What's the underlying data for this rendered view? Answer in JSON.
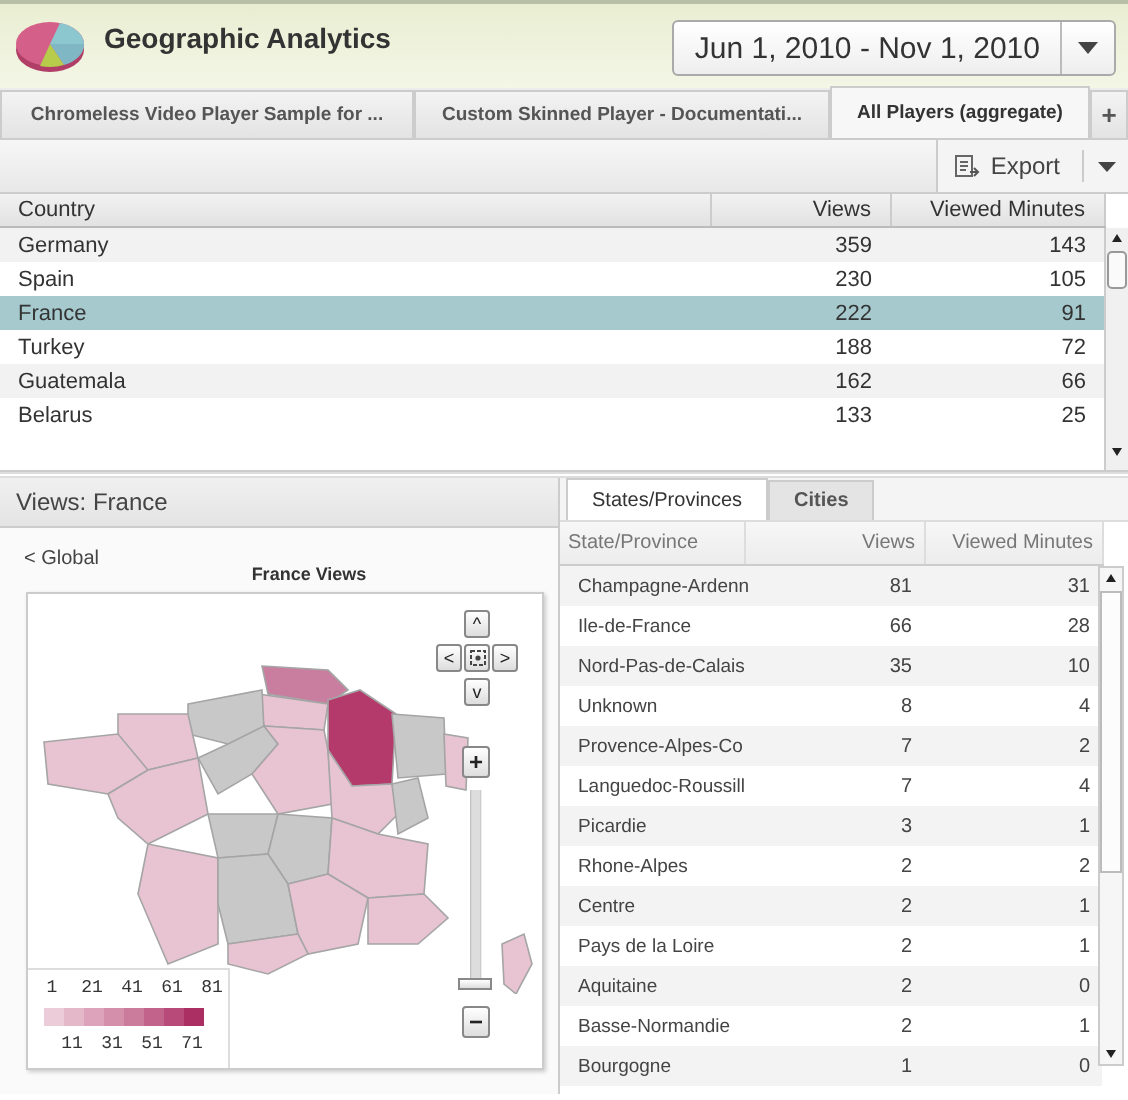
{
  "header": {
    "title": "Geographic Analytics",
    "date_range": "Jun 1, 2010 - Nov 1, 2010"
  },
  "tabs": [
    {
      "label": "Chromeless Video Player Sample for ...",
      "selected": false
    },
    {
      "label": "Custom Skinned Player - Documentati...",
      "selected": false
    },
    {
      "label": "All Players (aggregate)",
      "selected": true
    }
  ],
  "add_tab": "+",
  "toolbar": {
    "export": "Export"
  },
  "country_table": {
    "columns": [
      "Country",
      "Views",
      "Viewed Minutes"
    ],
    "rows": [
      {
        "cells": [
          "Germany",
          "359",
          "143"
        ],
        "selected": false
      },
      {
        "cells": [
          "Spain",
          "230",
          "105"
        ],
        "selected": false
      },
      {
        "cells": [
          "France",
          "222",
          "91"
        ],
        "selected": true
      },
      {
        "cells": [
          "Turkey",
          "188",
          "72"
        ],
        "selected": false
      },
      {
        "cells": [
          "Guatemala",
          "162",
          "66"
        ],
        "selected": false
      },
      {
        "cells": [
          "Belarus",
          "133",
          "25"
        ],
        "selected": false
      }
    ]
  },
  "detail": {
    "title": "Views: France",
    "back_link": "< Global",
    "map_title": "France Views",
    "pan_buttons": [
      "^",
      "<",
      ">",
      "v"
    ],
    "zoom_in": "+",
    "zoom_out": "−",
    "zoom": {
      "level": 0
    },
    "legend": {
      "top_labels": [
        "1",
        "21",
        "41",
        "61",
        "81"
      ],
      "bottom_labels": [
        "11",
        "31",
        "51",
        "71"
      ]
    }
  },
  "region_tabs": [
    {
      "label": "States/Provinces",
      "selected": true
    },
    {
      "label": "Cities",
      "selected": false
    }
  ],
  "region_table": {
    "columns": [
      "State/Province",
      "Views",
      "Viewed Minutes"
    ],
    "rows": [
      {
        "cells": [
          "Champagne-Ardenn",
          "81",
          "31"
        ]
      },
      {
        "cells": [
          "Ile-de-France",
          "66",
          "28"
        ]
      },
      {
        "cells": [
          "Nord-Pas-de-Calais",
          "35",
          "10"
        ]
      },
      {
        "cells": [
          "Unknown",
          "8",
          "4"
        ]
      },
      {
        "cells": [
          "Provence-Alpes-Co",
          "7",
          "2"
        ]
      },
      {
        "cells": [
          "Languedoc-Roussill",
          "7",
          "4"
        ]
      },
      {
        "cells": [
          "Picardie",
          "3",
          "1"
        ]
      },
      {
        "cells": [
          "Rhone-Alpes",
          "2",
          "2"
        ]
      },
      {
        "cells": [
          "Centre",
          "2",
          "1"
        ]
      },
      {
        "cells": [
          "Pays de la Loire",
          "2",
          "1"
        ]
      },
      {
        "cells": [
          "Aquitaine",
          "2",
          "0"
        ]
      },
      {
        "cells": [
          "Basse-Normandie",
          "2",
          "1"
        ]
      },
      {
        "cells": [
          "Bourgogne",
          "1",
          "0"
        ]
      }
    ]
  }
}
